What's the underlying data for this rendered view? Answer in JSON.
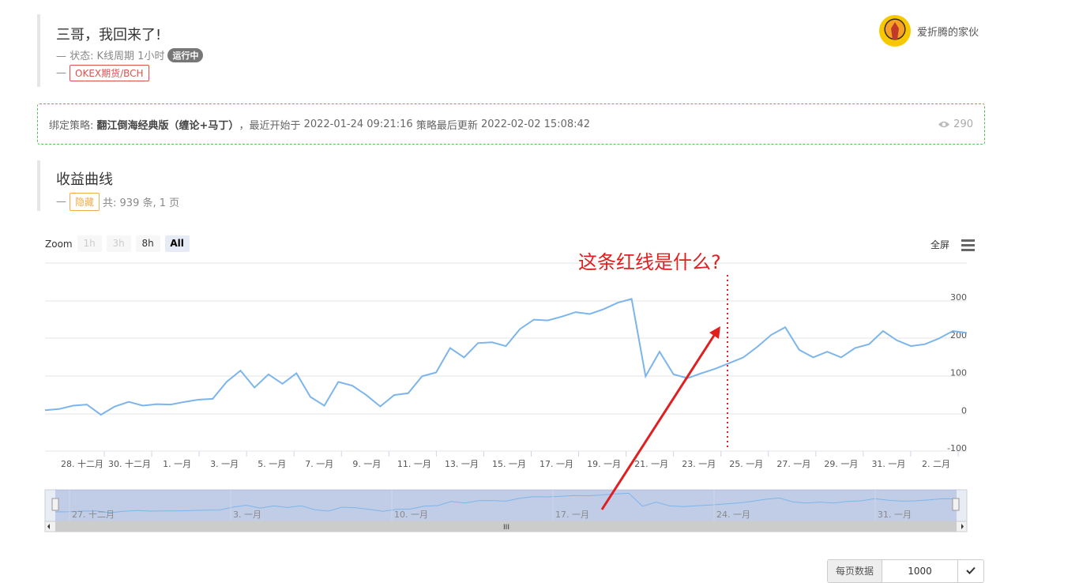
{
  "robot": {
    "title": "三哥，我回来了!",
    "status_prefix": "— 状态:",
    "status_text": "K线周期 1小时",
    "running_badge": "运行中",
    "exchange_prefix": "—",
    "exchange_tag": "OKEX期货/BCH"
  },
  "user": {
    "name": "爱折腾的家伙"
  },
  "strategy": {
    "bind_label": "绑定策略:",
    "name": "翻江倒海经典版（缠论+马丁）",
    "start_label": "，最近开始于",
    "start_time": "2022-01-24 09:21:16",
    "update_label": "策略最后更新",
    "update_time": "2022-02-02 15:08:42",
    "views": "290"
  },
  "profit": {
    "title": "收益曲线",
    "prefix": "—",
    "hide_tag": "隐藏",
    "summary": "共: 939 条, 1 页"
  },
  "zoom": {
    "label": "Zoom",
    "options": [
      "1h",
      "3h",
      "8h",
      "All"
    ],
    "selected": "All"
  },
  "fullscreen_label": "全屏",
  "annotation": {
    "text": "这条红线是什么?",
    "color": "#e02020"
  },
  "pager": {
    "label": "每页数据",
    "value": "1000"
  },
  "chart_data": {
    "type": "line",
    "title": "",
    "color": "#7cb5ec",
    "y_ticks": [
      "-100",
      "0",
      "100",
      "200",
      "300"
    ],
    "ylim": [
      -100,
      300
    ],
    "x_ticks": [
      "28. 十二月",
      "30. 十二月",
      "1. 一月",
      "3. 一月",
      "5. 一月",
      "7. 一月",
      "9. 一月",
      "11. 一月",
      "13. 一月",
      "15. 一月",
      "17. 一月",
      "19. 一月",
      "21. 一月",
      "23. 一月",
      "25. 一月",
      "27. 一月",
      "29. 一月",
      "31. 一月",
      "2. 二月"
    ],
    "navigator_ticks": [
      "27. 十二月",
      "3. 一月",
      "10. 一月",
      "17. 一月",
      "24. 一月",
      "31. 一月"
    ],
    "x": [
      "12-26",
      "12-27",
      "12-28",
      "12-29",
      "12-29.5",
      "12-30",
      "12-31",
      "01-01",
      "01-02",
      "01-03",
      "01-04",
      "01-05",
      "01-06",
      "01-06.5",
      "01-07",
      "01-07.5",
      "01-08",
      "01-08.5",
      "01-09",
      "01-09.3",
      "01-09.6",
      "01-10",
      "01-10.5",
      "01-11",
      "01-11.5",
      "01-12",
      "01-12.5",
      "01-13",
      "01-13.5",
      "01-14",
      "01-14.5",
      "01-15",
      "01-16",
      "01-17",
      "01-17.5",
      "01-18",
      "01-18.5",
      "01-19",
      "01-20",
      "01-20.5",
      "01-21",
      "01-21.5",
      "01-22",
      "01-22.2",
      "01-22.4",
      "01-23",
      "01-24",
      "01-24.5",
      "01-25",
      "01-25.5",
      "01-26",
      "01-26.5",
      "01-27",
      "01-27.5",
      "01-28",
      "01-28.5",
      "01-29",
      "01-29.5",
      "01-30",
      "01-30.5",
      "01-31",
      "01-31.5",
      "02-01",
      "02-01.5",
      "02-02",
      "02-02.5",
      "02-03"
    ],
    "values": [
      0,
      3,
      12,
      15,
      -12,
      10,
      22,
      12,
      16,
      15,
      22,
      28,
      30,
      75,
      105,
      60,
      95,
      70,
      98,
      35,
      12,
      75,
      65,
      40,
      10,
      40,
      45,
      90,
      100,
      165,
      140,
      178,
      180,
      170,
      215,
      240,
      238,
      248,
      260,
      255,
      268,
      285,
      295,
      90,
      155,
      95,
      85,
      98,
      110,
      125,
      140,
      168,
      200,
      220,
      160,
      140,
      155,
      140,
      165,
      175,
      210,
      185,
      170,
      175,
      190,
      210,
      205
    ]
  }
}
